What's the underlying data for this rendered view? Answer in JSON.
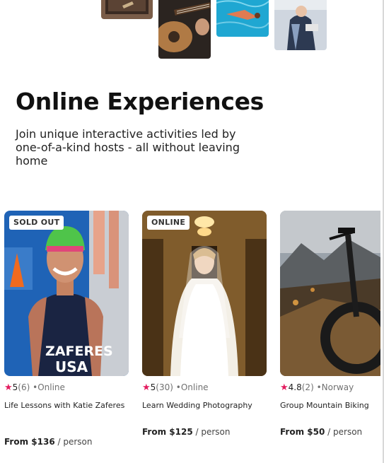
{
  "hero": {
    "images": [
      {
        "name": "hero-image-1",
        "alt": "Tabletop craft"
      },
      {
        "name": "hero-image-2",
        "alt": "Guitar playing"
      },
      {
        "name": "hero-image-3",
        "alt": "Swimming pool"
      },
      {
        "name": "hero-image-4",
        "alt": "Street performer"
      }
    ]
  },
  "section": {
    "title": "Online Experiences",
    "subtitle": "Join unique interactive activities led by one-of-a-kind hosts - all without leaving home"
  },
  "cards": [
    {
      "badge": "SOLD OUT",
      "score": "5",
      "reviews": "(6)",
      "location": "•Online",
      "title": "Life Lessons with Katie Zaferes",
      "price": "From $136",
      "unit": "/ person",
      "jersey_text_1": "ZAFERES",
      "jersey_text_2": "USA"
    },
    {
      "badge": "ONLINE",
      "score": "5",
      "reviews": "(30)",
      "location": "•Online",
      "title": "Learn Wedding Photography",
      "price": "From $125",
      "unit": "/ person"
    },
    {
      "badge": "",
      "score": "4.8",
      "reviews": "(2)",
      "location": "•Norway",
      "title": "Group Mountain Biking",
      "price": "From $50",
      "unit": "/ person"
    }
  ],
  "colors": {
    "star": "#e31c5f",
    "text_primary": "#222222",
    "text_secondary": "#717171"
  }
}
